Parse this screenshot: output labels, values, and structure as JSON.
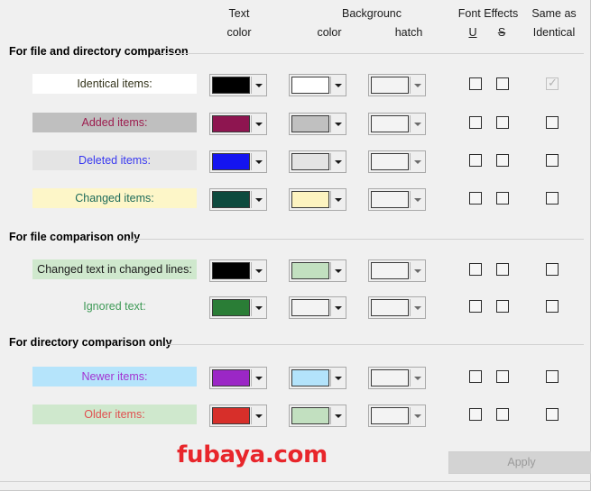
{
  "headers": {
    "text_color": {
      "line1": "Text",
      "line2": "color"
    },
    "background": {
      "line1": "Backgrounc",
      "line2_color": "color",
      "line2_hatch": "hatch"
    },
    "font_effects": {
      "title": "Font Effects",
      "underline": "U",
      "strikeout": "S"
    },
    "same_as": {
      "line1": "Same as",
      "line2": "Identical"
    }
  },
  "sections": [
    {
      "title": "For file and directory comparison",
      "rows": [
        {
          "label": "Identical items:",
          "label_text_color": "#33331a",
          "label_bg_color": "#ffffff",
          "text_color_swatch": "#000000",
          "background_color_swatch": "#ffffff",
          "hatch_swatch": "#f3f3f3",
          "underline_checked": false,
          "strikeout_checked": false,
          "same_as_identical_checked": true,
          "same_as_identical_disabled": true
        },
        {
          "label": "Added items:",
          "label_text_color": "#9c1c4e",
          "label_bg_color": "#bfbfbf",
          "text_color_swatch": "#8e1550",
          "background_color_swatch": "#c0c0c0",
          "hatch_swatch": "#f3f3f3",
          "underline_checked": false,
          "strikeout_checked": false,
          "same_as_identical_checked": false,
          "same_as_identical_disabled": false
        },
        {
          "label": "Deleted items:",
          "label_text_color": "#3838f0",
          "label_bg_color": "#e4e4e4",
          "text_color_swatch": "#1414f0",
          "background_color_swatch": "#e3e3e3",
          "hatch_swatch": "#f3f3f3",
          "underline_checked": false,
          "strikeout_checked": false,
          "same_as_identical_checked": false,
          "same_as_identical_disabled": false
        },
        {
          "label": "Changed items:",
          "label_text_color": "#1d6b5a",
          "label_bg_color": "#fdf6c8",
          "text_color_swatch": "#0d4a3e",
          "background_color_swatch": "#fdf3c0",
          "hatch_swatch": "#f3f3f3",
          "underline_checked": false,
          "strikeout_checked": false,
          "same_as_identical_checked": false,
          "same_as_identical_disabled": false
        }
      ]
    },
    {
      "title": "For file comparison only",
      "rows": [
        {
          "label": "Changed text in changed lines:",
          "label_text_color": "#1b1b1b",
          "label_bg_color": "#cfe8cd",
          "text_color_swatch": "#000000",
          "background_color_swatch": "#c2e0c0",
          "hatch_swatch": "#f3f3f3",
          "underline_checked": false,
          "strikeout_checked": false,
          "same_as_identical_checked": false,
          "same_as_identical_disabled": false
        },
        {
          "label": "Ignored text:",
          "label_text_color": "#3f9a57",
          "label_bg_color": "#f0f0f0",
          "text_color_swatch": "#2a7d36",
          "background_color_swatch": "#f3f3f3",
          "hatch_swatch": "#f3f3f3",
          "underline_checked": false,
          "strikeout_checked": false,
          "same_as_identical_checked": false,
          "same_as_identical_disabled": false
        }
      ]
    },
    {
      "title": "For directory comparison only",
      "rows": [
        {
          "label": "Newer items:",
          "label_text_color": "#a333d1",
          "label_bg_color": "#b5e4fb",
          "text_color_swatch": "#9b27c6",
          "background_color_swatch": "#b3e3fb",
          "hatch_swatch": "#f3f3f3",
          "underline_checked": false,
          "strikeout_checked": false,
          "same_as_identical_checked": false,
          "same_as_identical_disabled": false
        },
        {
          "label": "Older items:",
          "label_text_color": "#e05050",
          "label_bg_color": "#cfe8cd",
          "text_color_swatch": "#d72f2a",
          "background_color_swatch": "#c2e0c0",
          "hatch_swatch": "#f3f3f3",
          "underline_checked": false,
          "strikeout_checked": false,
          "same_as_identical_checked": false,
          "same_as_identical_disabled": false
        }
      ]
    }
  ],
  "watermark": "fubaya.com",
  "apply_button": {
    "label": "Apply",
    "disabled": true
  },
  "check_glyph": "✓"
}
